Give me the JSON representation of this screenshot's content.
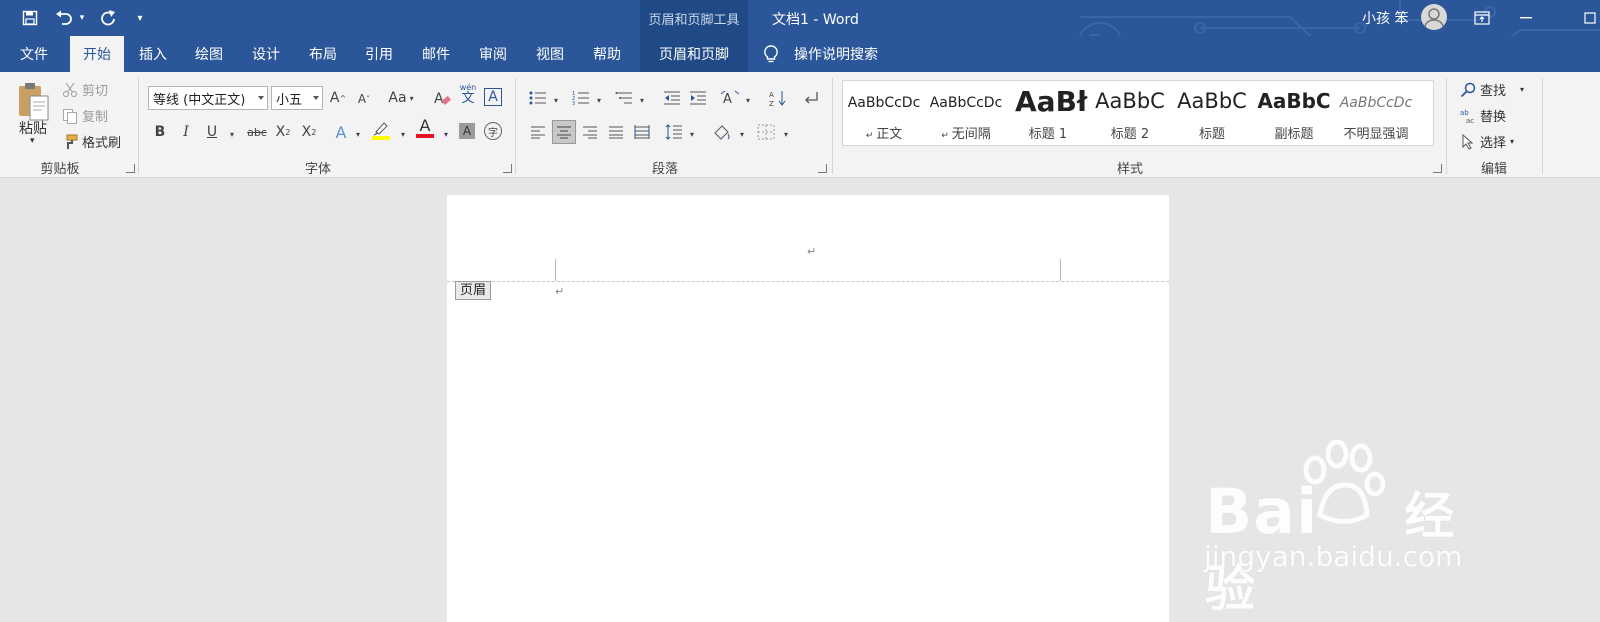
{
  "titlebar": {
    "context_tools": "页眉和页脚工具",
    "doc_title": "文档1  -  Word",
    "user_name": "小孩 笨",
    "quick_access": [
      "save-icon",
      "undo-icon",
      "redo-icon",
      "customize-icon"
    ]
  },
  "tabs": [
    "文件",
    "开始",
    "插入",
    "绘图",
    "设计",
    "布局",
    "引用",
    "邮件",
    "审阅",
    "视图",
    "帮助"
  ],
  "active_tab": "开始",
  "context_tab": "页眉和页脚",
  "tell_me": "操作说明搜索",
  "clipboard": {
    "paste": "粘贴",
    "cut": "剪切",
    "copy": "复制",
    "format_painter": "格式刷",
    "group_label": "剪贴板"
  },
  "font": {
    "family": "等线 (中文正文)",
    "size": "小五",
    "group_label": "字体",
    "grow": "A",
    "shrink": "A",
    "change_case": "Aa",
    "bold": "B",
    "italic": "I",
    "underline": "U",
    "strike": "abc",
    "subscript": "X",
    "superscript": "X",
    "phonetic_top": "wén",
    "phonetic": "文",
    "enclose": "字",
    "border_char": "A",
    "effects": "A",
    "color_a": "A",
    "shade_a": "A"
  },
  "paragraph": {
    "group_label": "段落"
  },
  "styles": {
    "group_label": "样式",
    "items": [
      {
        "preview": "AaBbCcDc",
        "name": "正文",
        "mark": "↵"
      },
      {
        "preview": "AaBbCcDc",
        "name": "无间隔",
        "mark": "↵"
      },
      {
        "preview": "AaBł",
        "name": "标题 1"
      },
      {
        "preview": "AaBbC",
        "name": "标题 2"
      },
      {
        "preview": "AaBbC",
        "name": "标题"
      },
      {
        "preview": "AaBbC",
        "name": "副标题"
      },
      {
        "preview": "AaBbCcDc",
        "name": "不明显强调"
      }
    ]
  },
  "editing": {
    "find": "查找",
    "replace": "替换",
    "select": "选择",
    "group_label": "编辑"
  },
  "document": {
    "header_tag": "页眉",
    "para_mark": "↵"
  },
  "watermark": {
    "logo": "Bai",
    "logo2": "经验",
    "url": "jingyan.baidu.com"
  },
  "colors": {
    "title_bg": "#2b579a",
    "ribbon_bg": "#f3f3f3",
    "canvas_bg": "#e6e6e6",
    "font_color_bar": "#e81123",
    "highlight_bar": "#ffff00"
  }
}
